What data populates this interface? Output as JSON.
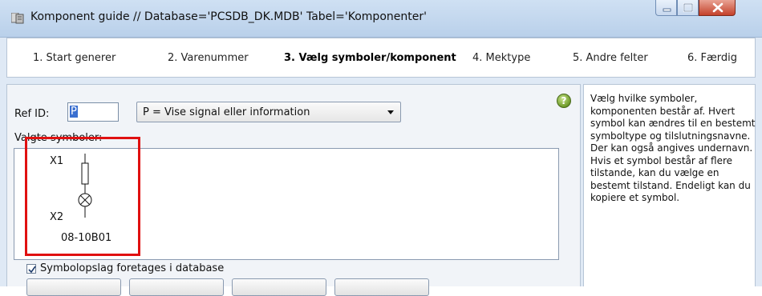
{
  "window": {
    "title": "Komponent guide  //  Database='PCSDB_DK.MDB' Tabel='Komponenter'"
  },
  "steps": [
    {
      "label": "1. Start generer",
      "active": false
    },
    {
      "label": "2. Varenummer",
      "active": false
    },
    {
      "label": "3. Vælg symboler/komponent",
      "active": true
    },
    {
      "label": "4. Mektype",
      "active": false
    },
    {
      "label": "5. Andre felter",
      "active": false
    },
    {
      "label": "6. Færdig",
      "active": false
    }
  ],
  "form": {
    "refid_label": "Ref ID:",
    "refid_value": "P",
    "type_select": "P = Vise signal eller information",
    "symbols_label": "Valgte symboler:"
  },
  "symbol": {
    "terminal_top": "X1",
    "terminal_bottom": "X2",
    "reference": "08-10B01"
  },
  "options": {
    "db_lookup_label": "Symbolopslag foretages i database",
    "db_lookup_checked": true
  },
  "help": {
    "text": "Vælg hvilke symboler, komponenten består af. Hvert symbol kan ændres til en bestemt symboltype og tilslutningsnavne. Der kan også angives undernavn. Hvis et symbol består af flere tilstande, kan du vælge en bestemt tilstand. Endeligt kan du kopiere et symbol."
  },
  "colors": {
    "highlight_frame": "#e01010",
    "selection": "#3a6fd0"
  }
}
